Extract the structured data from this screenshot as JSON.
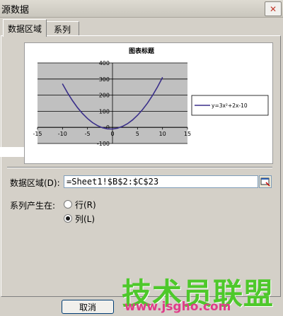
{
  "window": {
    "title": "源数据",
    "close_glyph": "✕"
  },
  "tabs": [
    {
      "label": "数据区域",
      "active": true
    },
    {
      "label": "系列",
      "active": false
    }
  ],
  "chart_data": {
    "type": "line",
    "title": "图表标题",
    "x_ticks": [
      "-15",
      "-10",
      "-5",
      "0",
      "5",
      "10",
      "15"
    ],
    "y_ticks": [
      "400",
      "300",
      "200",
      "100",
      "0",
      "-100"
    ],
    "xlim": [
      -15,
      15
    ],
    "ylim": [
      -100,
      400
    ],
    "grid": true,
    "legend_position": "right",
    "series": [
      {
        "name": "y=3x²+2x-10",
        "color": "#3a2f8a",
        "x": [
          -10,
          -9,
          -8,
          -7,
          -6,
          -5,
          -4,
          -3,
          -2,
          -1,
          0,
          1,
          2,
          3,
          4,
          5,
          6,
          7,
          8,
          9,
          10
        ],
        "y": [
          270,
          215,
          166,
          123,
          86,
          55,
          30,
          11,
          -2,
          -9,
          -10,
          -5,
          6,
          23,
          46,
          75,
          110,
          151,
          198,
          251,
          310
        ]
      }
    ]
  },
  "data_range": {
    "label": "数据区域(D):",
    "value": "=Sheet1!$B$2:$C$23"
  },
  "series_in": {
    "label": "系列产生在:",
    "options": [
      {
        "label": "行(R)",
        "selected": false
      },
      {
        "label": "列(L)",
        "selected": true
      }
    ]
  },
  "buttons": {
    "cancel": "取消"
  },
  "watermark": {
    "text": "技术员联盟",
    "url": "www.jsgho.com"
  },
  "colors": {
    "plot_area": "#c0c0c0",
    "gridline": "#000000"
  }
}
